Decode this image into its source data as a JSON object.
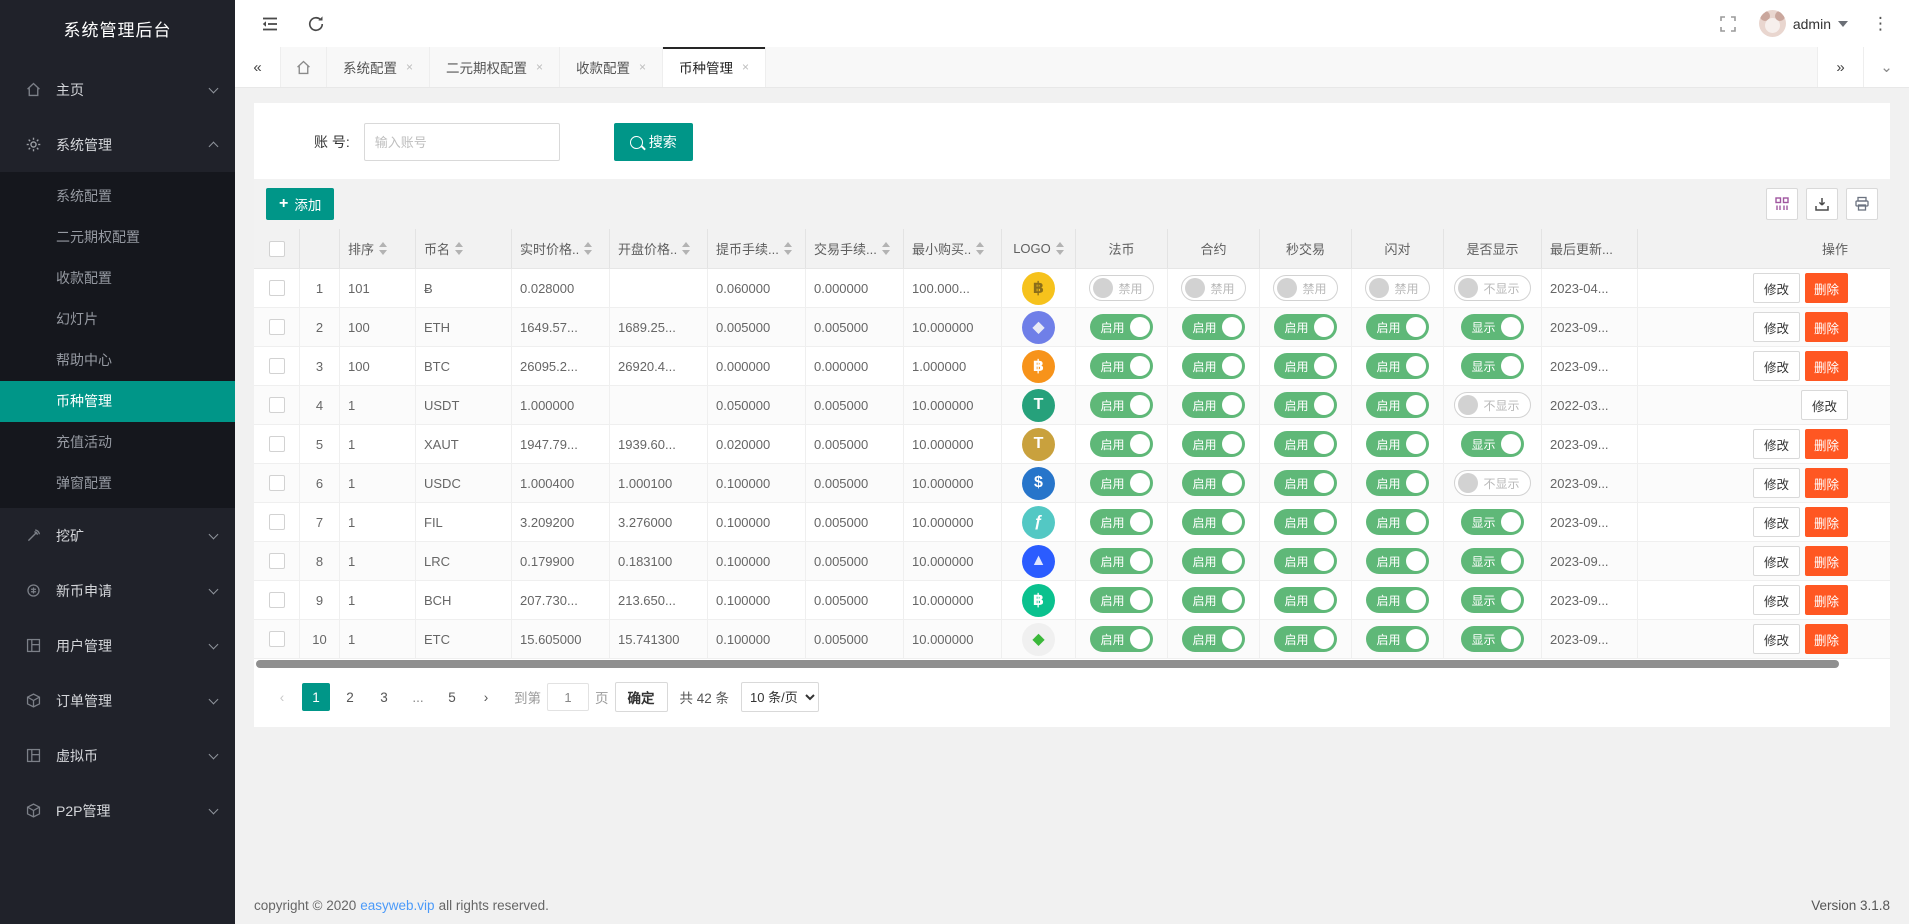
{
  "app": {
    "title": "系统管理后台",
    "version": "Version 3.1.8"
  },
  "topbar": {
    "user": "admin"
  },
  "tabbar": {
    "tabs": [
      {
        "label": "系统配置",
        "active": false
      },
      {
        "label": "二元期权配置",
        "active": false
      },
      {
        "label": "收款配置",
        "active": false
      },
      {
        "label": "币种管理",
        "active": true
      }
    ],
    "close_glyph": "×"
  },
  "sidebar": {
    "items": [
      {
        "label": "主页",
        "icon": "home"
      },
      {
        "label": "系统管理",
        "icon": "gear",
        "expanded": true,
        "children": [
          {
            "label": "系统配置"
          },
          {
            "label": "二元期权配置"
          },
          {
            "label": "收款配置"
          },
          {
            "label": "幻灯片"
          },
          {
            "label": "帮助中心"
          },
          {
            "label": "币种管理",
            "active": true
          },
          {
            "label": "充值活动"
          },
          {
            "label": "弹窗配置"
          }
        ]
      },
      {
        "label": "挖矿",
        "icon": "mine"
      },
      {
        "label": "新币申请",
        "icon": "newcoin"
      },
      {
        "label": "用户管理",
        "icon": "panel"
      },
      {
        "label": "订单管理",
        "icon": "cube"
      },
      {
        "label": "虚拟币",
        "icon": "panel"
      },
      {
        "label": "P2P管理",
        "icon": "cube"
      }
    ]
  },
  "search": {
    "label": "账 号:",
    "placeholder": "输入账号",
    "button": "搜索"
  },
  "toolbar": {
    "add": "添加"
  },
  "table": {
    "headers": [
      {
        "kind": "check"
      },
      {
        "kind": "index",
        "label": ""
      },
      {
        "label": "排序",
        "sort": true,
        "cls": "c-sort"
      },
      {
        "label": "币名",
        "sort": true,
        "cls": "c-name"
      },
      {
        "label": "实时价格..",
        "sort": true,
        "cls": "c-num"
      },
      {
        "label": "开盘价格..",
        "sort": true,
        "cls": "c-num"
      },
      {
        "label": "提币手续...",
        "sort": true,
        "cls": "c-num"
      },
      {
        "label": "交易手续...",
        "sort": true,
        "cls": "c-num"
      },
      {
        "label": "最小购买..",
        "sort": true,
        "cls": "c-num"
      },
      {
        "label": "LOGO",
        "sort": true,
        "cls": "c-logo"
      },
      {
        "label": "法币",
        "cls": "c-tog"
      },
      {
        "label": "合约",
        "cls": "c-tog"
      },
      {
        "label": "秒交易",
        "cls": "c-tog"
      },
      {
        "label": "闪对",
        "cls": "c-tog"
      },
      {
        "label": "是否显示",
        "cls": "c-show"
      },
      {
        "label": "最后更新...",
        "cls": "c-upd"
      },
      {
        "label": "操作",
        "cls": "c-act"
      }
    ],
    "toggle_labels": {
      "on": "启用",
      "off": "禁用",
      "show_on": "显示",
      "show_off": "不显示"
    },
    "actions": {
      "edit": "修改",
      "delete": "删除"
    },
    "rows": [
      {
        "idx": 1,
        "sort": "101",
        "name": "Ƀ",
        "price": "0.028000",
        "open": "",
        "wfee": "0.060000",
        "tfee": "0.000000",
        "min": "100.000...",
        "logo": {
          "bg": "#f6c21c",
          "sym": "฿",
          "color": "#8a6d1a"
        },
        "fiat": false,
        "contract": false,
        "seconds": false,
        "flash": false,
        "show": false,
        "updated": "2023-04...",
        "can_delete": true
      },
      {
        "idx": 2,
        "sort": "100",
        "name": "ETH",
        "price": "1649.57...",
        "open": "1689.25...",
        "wfee": "0.005000",
        "tfee": "0.005000",
        "min": "10.000000",
        "logo": {
          "bg": "#6f7fe8",
          "sym": "◆",
          "color": "#e8eaf5"
        },
        "fiat": true,
        "contract": true,
        "seconds": true,
        "flash": true,
        "show": true,
        "updated": "2023-09...",
        "can_delete": true
      },
      {
        "idx": 3,
        "sort": "100",
        "name": "BTC",
        "price": "26095.2...",
        "open": "26920.4...",
        "wfee": "0.000000",
        "tfee": "0.000000",
        "min": "1.000000",
        "logo": {
          "bg": "#f7931a",
          "sym": "฿",
          "color": "#ffffff"
        },
        "fiat": true,
        "contract": true,
        "seconds": true,
        "flash": true,
        "show": true,
        "updated": "2023-09...",
        "can_delete": true
      },
      {
        "idx": 4,
        "sort": "1",
        "name": "USDT",
        "price": "1.000000",
        "open": "",
        "wfee": "0.050000",
        "tfee": "0.005000",
        "min": "10.000000",
        "logo": {
          "bg": "#26a17b",
          "sym": "T",
          "color": "#ffffff"
        },
        "fiat": true,
        "contract": true,
        "seconds": true,
        "flash": true,
        "show": false,
        "updated": "2022-03...",
        "can_delete": false
      },
      {
        "idx": 5,
        "sort": "1",
        "name": "XAUT",
        "price": "1947.79...",
        "open": "1939.60...",
        "wfee": "0.020000",
        "tfee": "0.005000",
        "min": "10.000000",
        "logo": {
          "bg": "#c9a13d",
          "sym": "T",
          "color": "#ffffff"
        },
        "fiat": true,
        "contract": true,
        "seconds": true,
        "flash": true,
        "show": true,
        "updated": "2023-09...",
        "can_delete": true
      },
      {
        "idx": 6,
        "sort": "1",
        "name": "USDC",
        "price": "1.000400",
        "open": "1.000100",
        "wfee": "0.100000",
        "tfee": "0.005000",
        "min": "10.000000",
        "logo": {
          "bg": "#2775ca",
          "sym": "$",
          "color": "#ffffff"
        },
        "fiat": true,
        "contract": true,
        "seconds": true,
        "flash": true,
        "show": false,
        "updated": "2023-09...",
        "can_delete": true
      },
      {
        "idx": 7,
        "sort": "1",
        "name": "FIL",
        "price": "3.209200",
        "open": "3.276000",
        "wfee": "0.100000",
        "tfee": "0.005000",
        "min": "10.000000",
        "logo": {
          "bg": "#53c8c4",
          "sym": "ƒ",
          "color": "#ffffff"
        },
        "fiat": true,
        "contract": true,
        "seconds": true,
        "flash": true,
        "show": true,
        "updated": "2023-09...",
        "can_delete": true
      },
      {
        "idx": 8,
        "sort": "1",
        "name": "LRC",
        "price": "0.179900",
        "open": "0.183100",
        "wfee": "0.100000",
        "tfee": "0.005000",
        "min": "10.000000",
        "logo": {
          "bg": "#2b5cff",
          "sym": "▲",
          "color": "#dfe6ff"
        },
        "fiat": true,
        "contract": true,
        "seconds": true,
        "flash": true,
        "show": true,
        "updated": "2023-09...",
        "can_delete": true
      },
      {
        "idx": 9,
        "sort": "1",
        "name": "BCH",
        "price": "207.730...",
        "open": "213.650...",
        "wfee": "0.100000",
        "tfee": "0.005000",
        "min": "10.000000",
        "logo": {
          "bg": "#0ac18e",
          "sym": "฿",
          "color": "#ffffff"
        },
        "fiat": true,
        "contract": true,
        "seconds": true,
        "flash": true,
        "show": true,
        "updated": "2023-09...",
        "can_delete": true
      },
      {
        "idx": 10,
        "sort": "1",
        "name": "ETC",
        "price": "15.605000",
        "open": "15.741300",
        "wfee": "0.100000",
        "tfee": "0.005000",
        "min": "10.000000",
        "logo": {
          "bg": "#f0f0f0",
          "sym": "◆",
          "color": "#3ab83a"
        },
        "fiat": true,
        "contract": true,
        "seconds": true,
        "flash": true,
        "show": true,
        "updated": "2023-09...",
        "can_delete": true
      }
    ]
  },
  "pagination": {
    "prev": "‹",
    "next": "›",
    "pages": [
      "1",
      "2",
      "3",
      "...",
      "5"
    ],
    "active_page": "1",
    "jump_prefix": "到第",
    "jump_value": "1",
    "jump_suffix": "页",
    "confirm": "确定",
    "total": "共 42 条",
    "page_size": "10 条/页"
  },
  "footer": {
    "copyright_prefix": "copyright © 2020",
    "link": "easyweb.vip",
    "copyright_suffix": "all rights reserved.",
    "version": "Version 3.1.8"
  },
  "colors": {
    "accent": "#009688",
    "toggle_on": "#5FB878",
    "danger": "#FF5722",
    "sidebar_bg": "#20222a"
  }
}
